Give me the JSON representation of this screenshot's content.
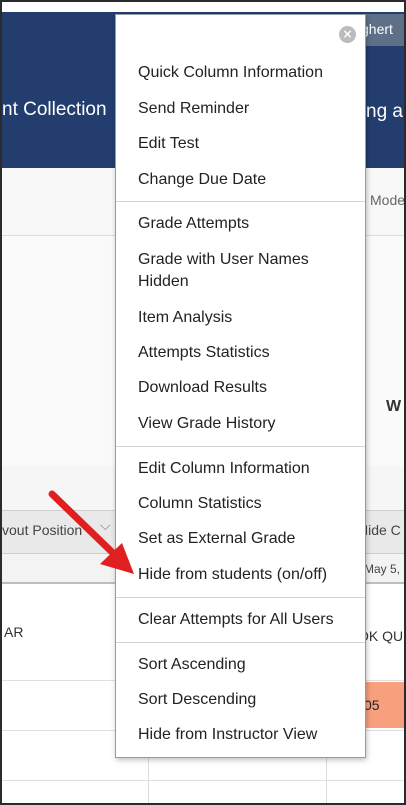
{
  "header": {
    "user_name_partial": "ghert",
    "left_title_partial": "nt Collection",
    "right_title_partial": "ng ar"
  },
  "toolbar": {
    "mode_partial": "Mode"
  },
  "content": {
    "column_heading_partial": "W"
  },
  "grid": {
    "left_column_header": "vout Position",
    "right_column_header": "Hide C",
    "right_column_date": "May 5,",
    "row1_left": "AR",
    "row1_right": "OK QU",
    "row2_right_value": "05"
  },
  "menu": {
    "close_symbol": "×",
    "groups": [
      [
        "Quick Column Information",
        "Send Reminder",
        "Edit Test",
        "Change Due Date"
      ],
      [
        "Grade Attempts",
        "Grade with User Names",
        "Hidden",
        "Item Analysis",
        "Attempts Statistics",
        "Download Results",
        "View Grade History"
      ],
      [
        "Edit Column Information",
        "Column Statistics",
        "Set as External Grade",
        "Hide from students (on/off)"
      ],
      [
        "Clear Attempts for All Users"
      ],
      [
        "Sort Ascending",
        "Sort Descending",
        "Hide from Instructor View"
      ]
    ]
  },
  "colors": {
    "header_background": "#233e6e",
    "arrow": "#e02020",
    "highlight_cell": "#f8a07e"
  }
}
